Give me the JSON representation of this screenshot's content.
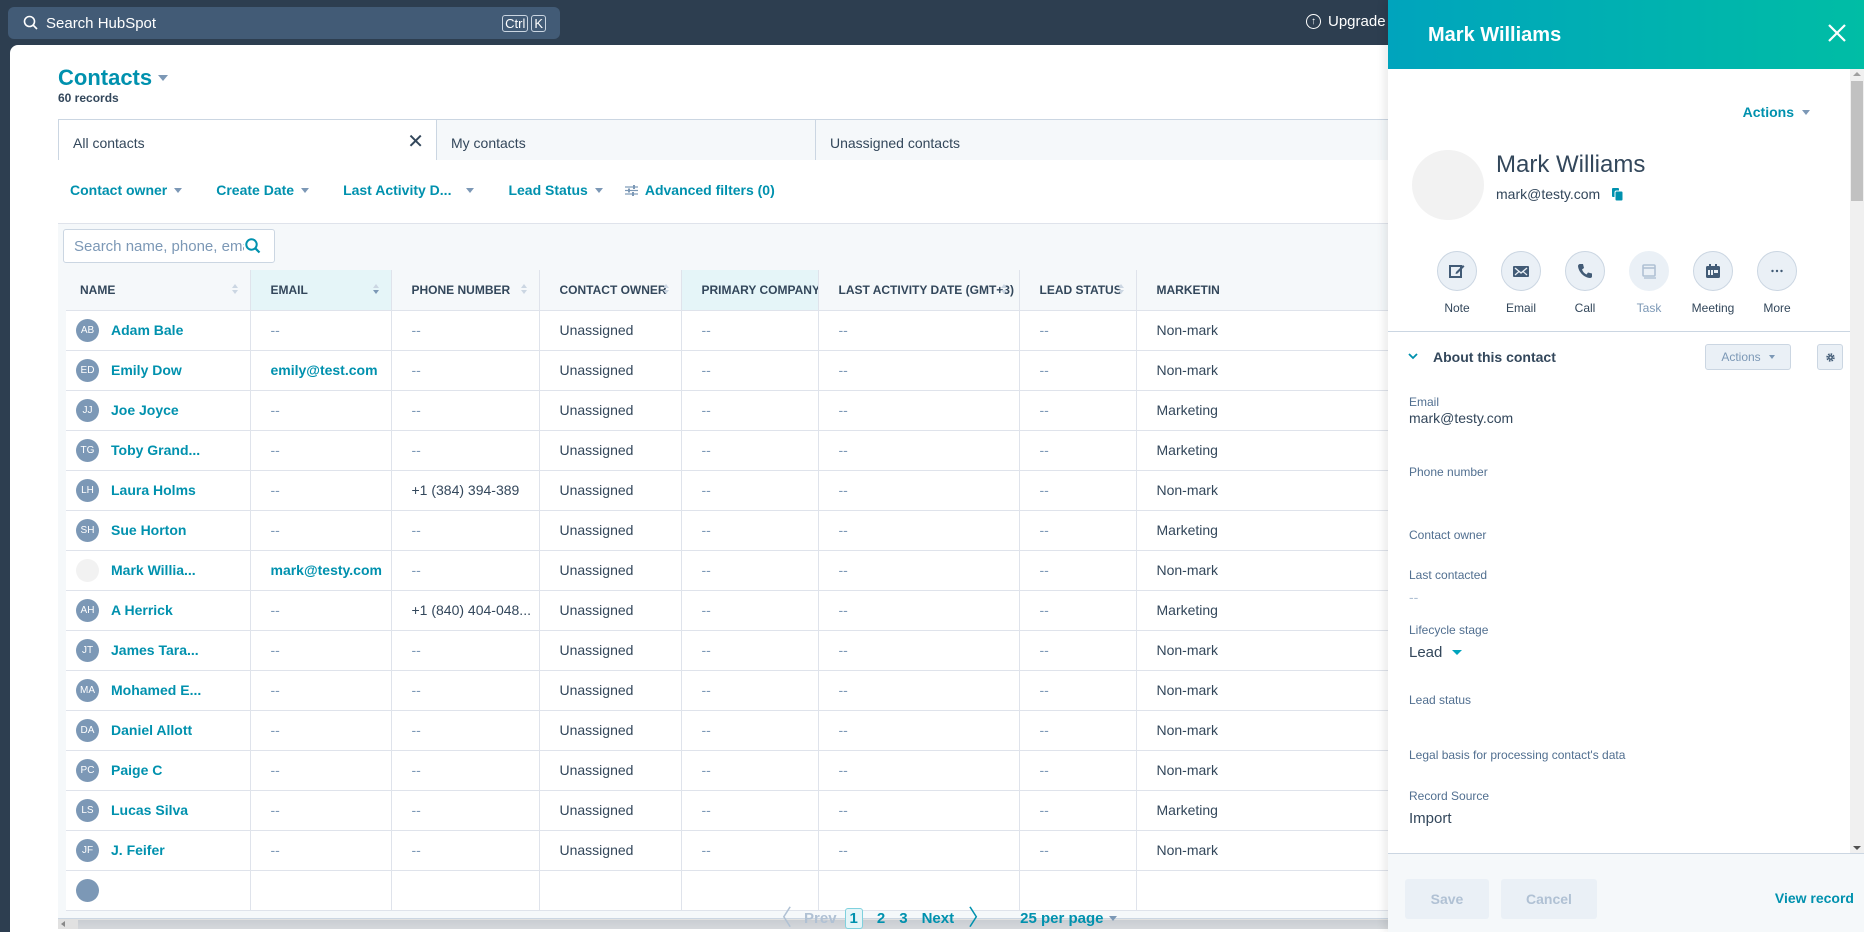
{
  "topnav": {
    "search_label": "Search HubSpot",
    "shortcut_keys": [
      "Ctrl",
      "K"
    ],
    "upgrade_label": "Upgrade"
  },
  "page": {
    "title": "Contacts",
    "record_count": "60 records"
  },
  "view_tabs": [
    {
      "label": "All contacts",
      "active": true,
      "closable": true
    },
    {
      "label": "My contacts",
      "active": false
    },
    {
      "label": "Unassigned contacts",
      "active": false
    }
  ],
  "filters": [
    {
      "label": "Contact owner"
    },
    {
      "label": "Create Date"
    },
    {
      "label": "Last Activity D..."
    },
    {
      "label": "Lead Status"
    }
  ],
  "advanced_filters_label": "Advanced filters (0)",
  "table": {
    "search_placeholder": "Search name, phone, email",
    "columns": [
      "Name",
      "Email",
      "Phone number",
      "Contact owner",
      "Primary company",
      "Last activity date (GMT+3)",
      "Lead status",
      "Marketin"
    ],
    "sorted_column": "Email",
    "rows": [
      {
        "initials": "AB",
        "name": "Adam Bale",
        "email": "--",
        "phone": "--",
        "owner": "Unassigned",
        "company": "--",
        "last_activity": "--",
        "lead_status": "--",
        "marketing": "Non-mark"
      },
      {
        "initials": "ED",
        "name": "Emily Dow",
        "email": "emily@test.com",
        "phone": "--",
        "owner": "Unassigned",
        "company": "--",
        "last_activity": "--",
        "lead_status": "--",
        "marketing": "Non-mark"
      },
      {
        "initials": "JJ",
        "name": "Joe Joyce",
        "email": "--",
        "phone": "--",
        "owner": "Unassigned",
        "company": "--",
        "last_activity": "--",
        "lead_status": "--",
        "marketing": "Marketing"
      },
      {
        "initials": "TG",
        "name": "Toby Grand...",
        "email": "--",
        "phone": "--",
        "owner": "Unassigned",
        "company": "--",
        "last_activity": "--",
        "lead_status": "--",
        "marketing": "Marketing"
      },
      {
        "initials": "LH",
        "name": "Laura Holms",
        "email": "--",
        "phone": "+1 (384) 394-389",
        "owner": "Unassigned",
        "company": "--",
        "last_activity": "--",
        "lead_status": "--",
        "marketing": "Non-mark"
      },
      {
        "initials": "SH",
        "name": "Sue Horton",
        "email": "--",
        "phone": "--",
        "owner": "Unassigned",
        "company": "--",
        "last_activity": "--",
        "lead_status": "--",
        "marketing": "Marketing"
      },
      {
        "initials": "",
        "name": "Mark Willia...",
        "email": "mark@testy.com",
        "phone": "--",
        "owner": "Unassigned",
        "company": "--",
        "last_activity": "--",
        "lead_status": "--",
        "marketing": "Non-mark"
      },
      {
        "initials": "AH",
        "name": "A Herrick",
        "email": "--",
        "phone": "+1 (840) 404-048...",
        "owner": "Unassigned",
        "company": "--",
        "last_activity": "--",
        "lead_status": "--",
        "marketing": "Marketing"
      },
      {
        "initials": "JT",
        "name": "James Tara...",
        "email": "--",
        "phone": "--",
        "owner": "Unassigned",
        "company": "--",
        "last_activity": "--",
        "lead_status": "--",
        "marketing": "Non-mark"
      },
      {
        "initials": "MA",
        "name": "Mohamed E...",
        "email": "--",
        "phone": "--",
        "owner": "Unassigned",
        "company": "--",
        "last_activity": "--",
        "lead_status": "--",
        "marketing": "Non-mark"
      },
      {
        "initials": "DA",
        "name": "Daniel Allott",
        "email": "--",
        "phone": "--",
        "owner": "Unassigned",
        "company": "--",
        "last_activity": "--",
        "lead_status": "--",
        "marketing": "Non-mark"
      },
      {
        "initials": "PC",
        "name": "Paige C",
        "email": "--",
        "phone": "--",
        "owner": "Unassigned",
        "company": "--",
        "last_activity": "--",
        "lead_status": "--",
        "marketing": "Non-mark"
      },
      {
        "initials": "LS",
        "name": "Lucas Silva",
        "email": "--",
        "phone": "--",
        "owner": "Unassigned",
        "company": "--",
        "last_activity": "--",
        "lead_status": "--",
        "marketing": "Marketing"
      },
      {
        "initials": "JF",
        "name": "J. Feifer",
        "email": "--",
        "phone": "--",
        "owner": "Unassigned",
        "company": "--",
        "last_activity": "--",
        "lead_status": "--",
        "marketing": "Non-mark"
      }
    ]
  },
  "pagination": {
    "prev_label": "Prev",
    "pages": [
      "1",
      "2",
      "3"
    ],
    "current_page": "1",
    "next_label": "Next",
    "per_page_label": "25 per page"
  },
  "panel": {
    "header_title": "Mark Williams",
    "actions_label": "Actions",
    "contact_name": "Mark Williams",
    "contact_email": "mark@testy.com",
    "activity_buttons": [
      {
        "label": "Note",
        "icon": "note-icon",
        "disabled": false
      },
      {
        "label": "Email",
        "icon": "email-icon",
        "disabled": false
      },
      {
        "label": "Call",
        "icon": "call-icon",
        "disabled": false
      },
      {
        "label": "Task",
        "icon": "task-icon",
        "disabled": true
      },
      {
        "label": "Meeting",
        "icon": "meeting-icon",
        "disabled": false
      },
      {
        "label": "More",
        "icon": "more-icon",
        "disabled": false
      }
    ],
    "section_title": "About this contact",
    "section_actions_label": "Actions",
    "fields": [
      {
        "label": "Email",
        "value": "mark@testy.com"
      },
      {
        "label": "Phone number",
        "value": ""
      },
      {
        "label": "Contact owner",
        "value": ""
      },
      {
        "label": "Last contacted",
        "value": "--"
      },
      {
        "label": "Lifecycle stage",
        "value": "Lead"
      },
      {
        "label": "Lead status",
        "value": ""
      },
      {
        "label": "Legal basis for processing contact's data",
        "value": ""
      },
      {
        "label": "Record Source",
        "value": "Import"
      }
    ],
    "save_label": "Save",
    "cancel_label": "Cancel",
    "view_record_label": "View record"
  },
  "colors": {
    "brand_teal": "#0091ae",
    "header_gradient_start": "#00a4bd",
    "header_gradient_end": "#00bda5",
    "nav_dark": "#2d3e50",
    "text_primary": "#33475b",
    "avatar_grey": "#7c98b6"
  }
}
